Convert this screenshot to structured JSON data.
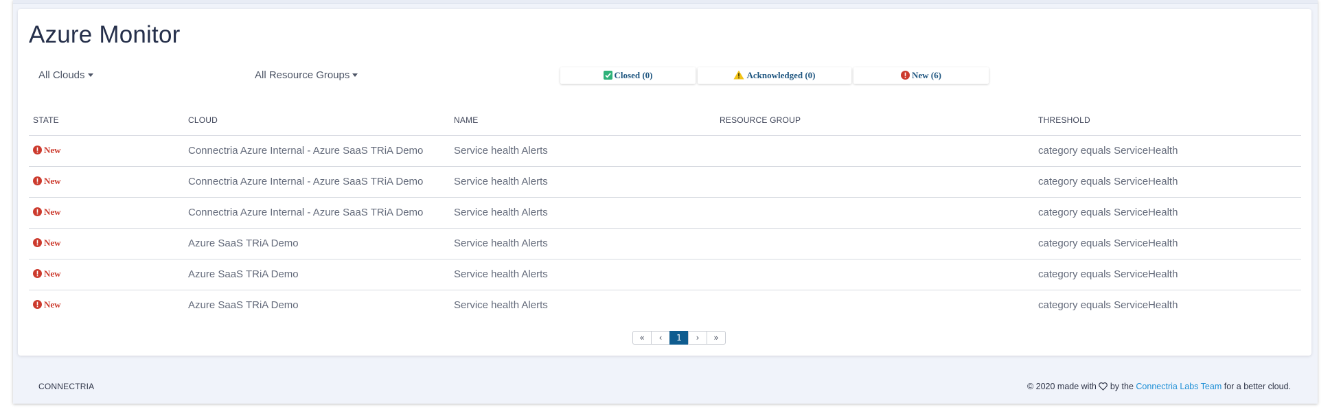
{
  "page": {
    "title": "Azure Monitor"
  },
  "filters": {
    "clouds_label": "All Clouds",
    "resource_groups_label": "All Resource Groups"
  },
  "status_tabs": {
    "closed": "Closed (0)",
    "acknowledged": "Acknowledged (0)",
    "new": "New (6)"
  },
  "table": {
    "headers": {
      "state": "STATE",
      "cloud": "CLOUD",
      "name": "NAME",
      "resource_group": "RESOURCE GROUP",
      "threshold": "THRESHOLD"
    },
    "rows": [
      {
        "state": "New",
        "cloud": "Connectria Azure Internal - Azure SaaS TRiA Demo",
        "name": "Service health Alerts",
        "resource_group": "",
        "threshold": "category equals ServiceHealth"
      },
      {
        "state": "New",
        "cloud": "Connectria Azure Internal - Azure SaaS TRiA Demo",
        "name": "Service health Alerts",
        "resource_group": "",
        "threshold": "category equals ServiceHealth"
      },
      {
        "state": "New",
        "cloud": "Connectria Azure Internal - Azure SaaS TRiA Demo",
        "name": "Service health Alerts",
        "resource_group": "",
        "threshold": "category equals ServiceHealth"
      },
      {
        "state": "New",
        "cloud": "Azure SaaS TRiA Demo",
        "name": "Service health Alerts",
        "resource_group": "",
        "threshold": "category equals ServiceHealth"
      },
      {
        "state": "New",
        "cloud": "Azure SaaS TRiA Demo",
        "name": "Service health Alerts",
        "resource_group": "",
        "threshold": "category equals ServiceHealth"
      },
      {
        "state": "New",
        "cloud": "Azure SaaS TRiA Demo",
        "name": "Service health Alerts",
        "resource_group": "",
        "threshold": "category equals ServiceHealth"
      }
    ]
  },
  "pagination": {
    "first": "«",
    "prev": "‹",
    "current": "1",
    "next": "›",
    "last": "»"
  },
  "footer": {
    "brand": "CONNECTRIA",
    "copyright_prefix": "© 2020 made with",
    "by_the": "by the",
    "team_link": "Connectria Labs Team",
    "suffix": "for a better cloud."
  },
  "colors": {
    "closed_icon": "#2fb27a",
    "acknowledged_icon": "#f2c318",
    "new_icon": "#cc3a2d",
    "pagination_active": "#0f5c8f",
    "link": "#1e8fd6"
  },
  "icons": {
    "closed": "check-square-icon",
    "acknowledged": "warning-triangle-icon",
    "new": "exclamation-circle-icon",
    "footer_heart": "heart-outline-icon"
  }
}
